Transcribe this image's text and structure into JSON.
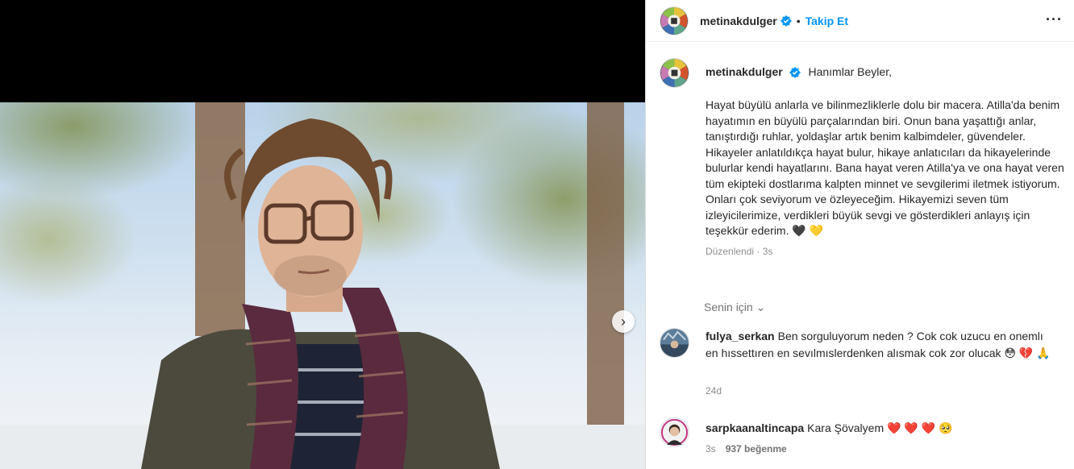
{
  "post": {
    "username": "metinakdulger",
    "follow_label": "Takip Et",
    "more_label": "···",
    "separator": "•",
    "next_label": "›"
  },
  "caption": {
    "username": "metinakdulger",
    "greeting": "Hanımlar Beyler,",
    "body": "Hayat büyülü anlarla ve bilinmezliklerle dolu bir macera. Atilla'da benim hayatımın en büyülü parçalarından biri. Onun bana yaşattığı anlar, tanıştırdığı ruhlar, yoldaşlar artık benim kalbimdeler, güvendeler. Hikayeler anlatıldıkça hayat bulur, hikaye anlatıcıları da hikayelerinde bulurlar kendi hayatlarını. Bana hayat veren Atilla'ya ve ona hayat veren tüm ekipteki dostlarıma kalpten minnet ve sevgilerimi iletmek istiyorum. Onları çok seviyorum ve özleyeceğim. Hikayemizi seven tüm izleyicilerimize, verdikleri büyük sevgi ve gösterdikleri anlayış için teşekkür ederim. 🖤 💛",
    "meta": "Düzenlendi · 3s"
  },
  "sort": {
    "label": "Senin için ⌄"
  },
  "comments": [
    {
      "username": "fulya_serkan",
      "text": "Ben sorguluyorum neden ? Cok cok uzucu en onemlı en hıssettıren en sevılmıslerdenken alısmak cok zor olucak 😳 💔 🙏",
      "time": "24d",
      "likes": ""
    },
    {
      "username": "sarpkaanaltincapa",
      "text": "Kara Şövalyem ❤️ ❤️ ❤️ 🥺",
      "time": "3s",
      "likes": "937 beğenme"
    }
  ],
  "colors": {
    "accent": "#0095f6",
    "verified": "#0095f6",
    "muted": "#8e8e8e"
  }
}
